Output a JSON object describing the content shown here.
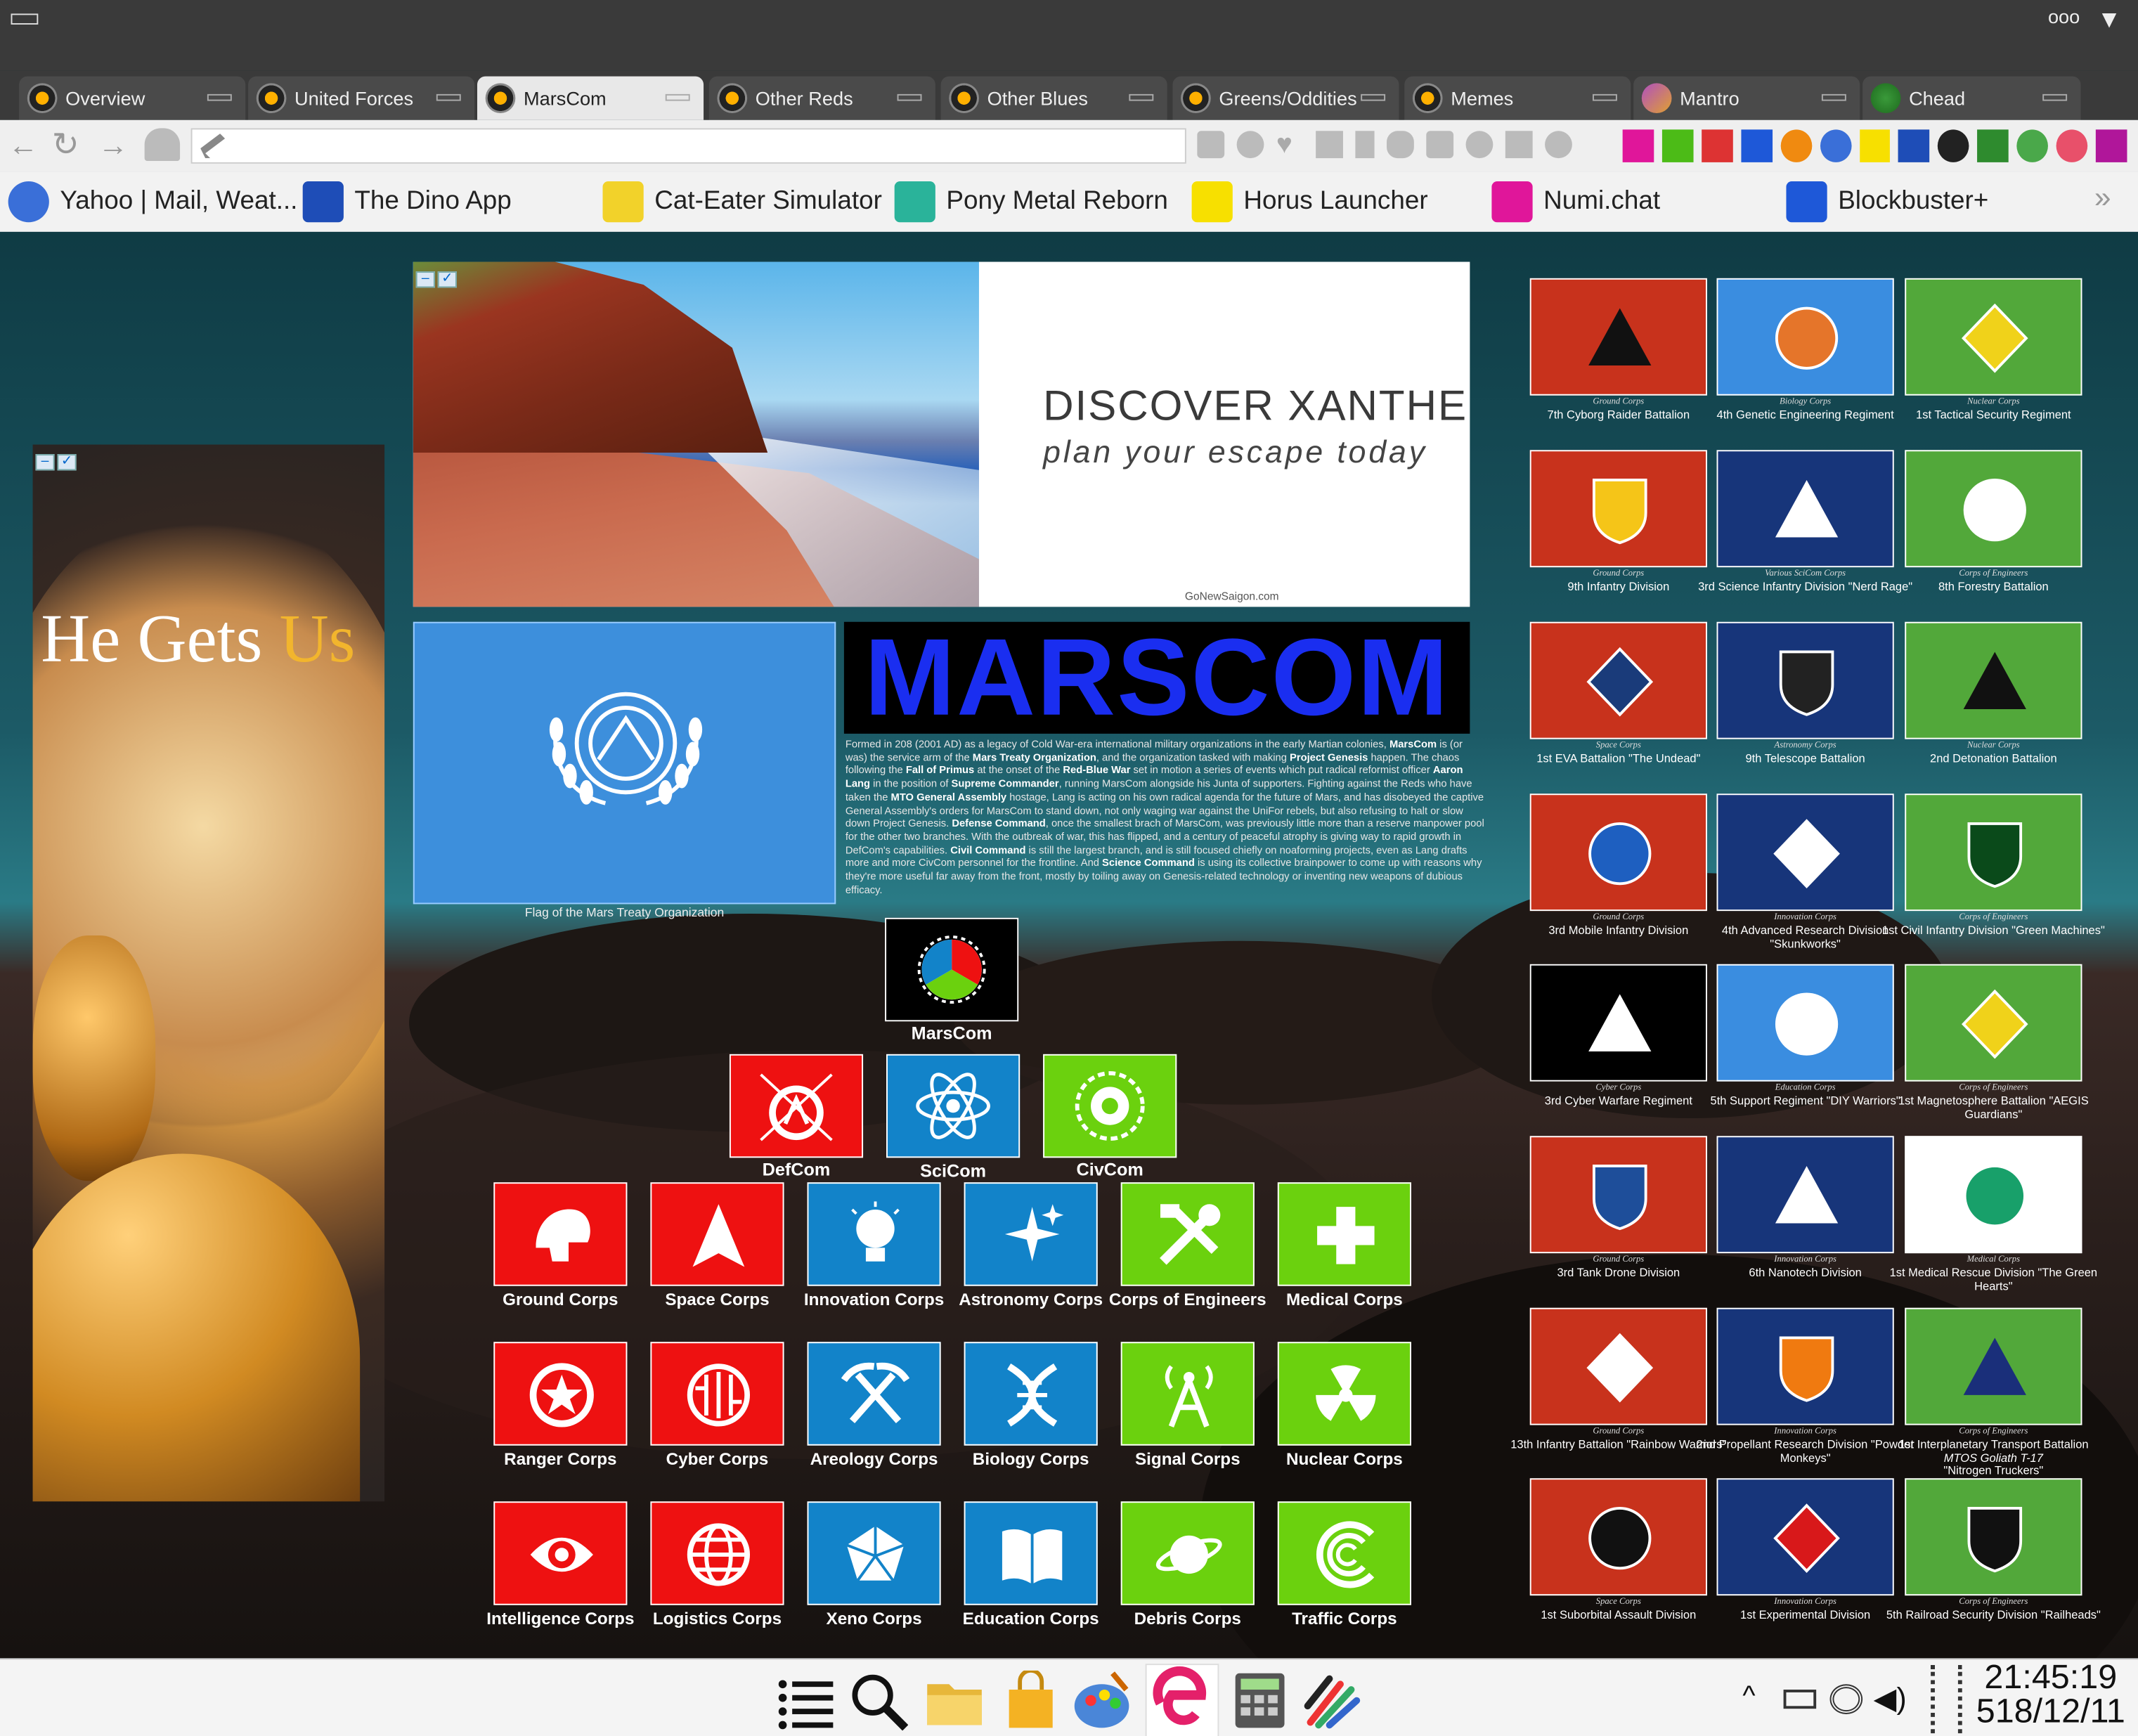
{
  "tabs": [
    {
      "label": "Overview",
      "active": false
    },
    {
      "label": "United Forces",
      "active": false
    },
    {
      "label": "MarsCom",
      "active": true
    },
    {
      "label": "Other Reds",
      "active": false
    },
    {
      "label": "Other Blues",
      "active": false
    },
    {
      "label": "Greens/Oddities",
      "active": false
    },
    {
      "label": "Memes",
      "active": false
    },
    {
      "label": "Mantro",
      "active": false
    },
    {
      "label": "Chead",
      "active": false
    }
  ],
  "bookmarks": [
    {
      "label": "Yahoo | Mail, Weat...",
      "icon": "globe-icon",
      "color": "#3a6fd8"
    },
    {
      "label": "The Dino App",
      "icon": "un-emblem-icon",
      "color": "#1e4db7"
    },
    {
      "label": "Cat-Eater Simulator",
      "icon": "cat-icon",
      "color": "#f2d22a"
    },
    {
      "label": "Pony Metal Reborn",
      "icon": "pony-icon",
      "color": "#2ab39a"
    },
    {
      "label": "Horus Launcher",
      "icon": "horus-icon",
      "color": "#f7e000"
    },
    {
      "label": "Numi.chat",
      "icon": "numi-icon",
      "color": "#e0169a"
    },
    {
      "label": "Blockbuster+",
      "icon": "blockbuster-icon",
      "color": "#1e58d8"
    }
  ],
  "titlebar": {
    "menu_glyph": "▭",
    "dots": "ooo",
    "chevron": "▼"
  },
  "bookmark_overflow": "»",
  "buddha": {
    "text_part1": "He Gets ",
    "text_part2": "Us"
  },
  "ad": {
    "headline": "DISCOVER XANTHE",
    "tagline": "plan your escape today",
    "source": "GoNewSaigon.com"
  },
  "flag": {
    "caption": "Flag of the Mars Treaty Organization",
    "color": "#3d8fdc"
  },
  "marscom": {
    "title": "MARSCOM",
    "description_html": "Formed in 208 (2001 AD) as a legacy of Cold War-era international military organizations in the early Martian colonies, <b>MarsCom</b> is (or was) the service arm of the <b>Mars Treaty Organization</b>, and the organization tasked with making <b>Project Genesis</b> happen. The chaos following the <b>Fall of Primus</b> at the onset of the <b>Red-Blue War</b> set in motion a series of events which put radical reformist officer <b>Aaron Lang</b> in the position of <b>Supreme Commander</b>, running MarsCom alongside his Junta of supporters. Fighting against the Reds who have taken the <b>MTO General Assembly</b> hostage, Lang is acting on his own radical agenda for the future of Mars, and has disobeyed the captive General Assembly's orders for MarsCom to stand down, not only waging war against the UniFor rebels, but also refusing to halt or slow down Project Genesis. <b>Defense Command</b>, once the smallest brach of MarsCom, was previously little more than a reserve manpower pool for the other two branches. With the outbreak of war, this has flipped, and a century of peaceful atrophy is giving way to rapid growth in DefCom's capabilities. <b>Civil Command</b> is still the largest branch, and is still focused chiefly on noaforming projects, even as Lang drafts more and more CivCom personnel for the frontline. And <b>Science Command</b> is using its collective brainpower to come up with reasons why they're more useful far away from the front, mostly by toiling away on Genesis-related technology or inventing new weapons of dubious efficacy."
  },
  "org": {
    "root": "MarsCom",
    "branches": [
      {
        "label": "DefCom",
        "color": "#ee1111"
      },
      {
        "label": "SciCom",
        "color": "#1283c9"
      },
      {
        "label": "CivCom",
        "color": "#6bd10e"
      }
    ]
  },
  "corps": [
    {
      "label": "Ground Corps",
      "color": "red",
      "icon": "helmet-icon"
    },
    {
      "label": "Space Corps",
      "color": "red",
      "icon": "arrowhead-icon"
    },
    {
      "label": "Innovation Corps",
      "color": "blue",
      "icon": "lightbulb-icon"
    },
    {
      "label": "Astronomy Corps",
      "color": "blue",
      "icon": "stars-icon"
    },
    {
      "label": "Corps of Engineers",
      "color": "green",
      "icon": "tools-icon"
    },
    {
      "label": "Medical Corps",
      "color": "green",
      "icon": "cross-icon"
    },
    {
      "label": "Ranger Corps",
      "color": "red",
      "icon": "star-badge-icon"
    },
    {
      "label": "Cyber Corps",
      "color": "red",
      "icon": "circuit-icon"
    },
    {
      "label": "Areology Corps",
      "color": "blue",
      "icon": "pickaxes-icon"
    },
    {
      "label": "Biology Corps",
      "color": "blue",
      "icon": "dna-icon"
    },
    {
      "label": "Signal Corps",
      "color": "green",
      "icon": "antenna-icon"
    },
    {
      "label": "Nuclear Corps",
      "color": "green",
      "icon": "radiation-icon"
    },
    {
      "label": "Intelligence Corps",
      "color": "red",
      "icon": "eye-icon"
    },
    {
      "label": "Logistics Corps",
      "color": "red",
      "icon": "globe-icon"
    },
    {
      "label": "Xeno Corps",
      "color": "blue",
      "icon": "polyhedron-icon"
    },
    {
      "label": "Education Corps",
      "color": "blue",
      "icon": "book-icon"
    },
    {
      "label": "Debris Corps",
      "color": "green",
      "icon": "planet-icon"
    },
    {
      "label": "Traffic Corps",
      "color": "green",
      "icon": "spiral-icon"
    }
  ],
  "units": [
    {
      "corps": "Ground Corps",
      "name": "7th Cyborg Raider Battalion",
      "bg": "#c8321c",
      "accent": "#111"
    },
    {
      "corps": "Biology Corps",
      "name": "4th Genetic Engineering Regiment",
      "bg": "#3a8de0",
      "accent": "#e5752a"
    },
    {
      "corps": "Nuclear Corps",
      "name": "1st Tactical Security Regiment",
      "bg": "#52a83a",
      "accent": "#f0d21a"
    },
    {
      "corps": "Ground Corps",
      "name": "9th Infantry Division",
      "bg": "#c8321c",
      "accent": "#f5c518"
    },
    {
      "corps": "Various SciCom Corps",
      "name": "3rd Science Infantry Division \"Nerd Rage\"",
      "bg": "#17357a",
      "accent": "#fff"
    },
    {
      "corps": "Corps of Engineers",
      "name": "8th Forestry Battalion",
      "bg": "#52a83a",
      "accent": "#fff"
    },
    {
      "corps": "Space Corps",
      "name": "1st EVA Battalion \"The Undead\"",
      "bg": "#c8321c",
      "accent": "#1a3b7a"
    },
    {
      "corps": "Astronomy Corps",
      "name": "9th Telescope Battalion",
      "bg": "#17357a",
      "accent": "#222"
    },
    {
      "corps": "Nuclear Corps",
      "name": "2nd Detonation Battalion",
      "bg": "#52a83a",
      "accent": "#111"
    },
    {
      "corps": "Ground Corps",
      "name": "3rd Mobile Infantry Division",
      "bg": "#c8321c",
      "accent": "#1e5fc0"
    },
    {
      "corps": "Innovation Corps",
      "name": "4th Advanced Research Division \"Skunkworks\"",
      "bg": "#17357a",
      "accent": "#fff"
    },
    {
      "corps": "Corps of Engineers",
      "name": "1st Civil Infantry Division \"Green Machines\"",
      "bg": "#52a83a",
      "accent": "#0a4a1a"
    },
    {
      "corps": "Cyber Corps",
      "name": "3rd Cyber Warfare Regiment",
      "bg": "#000",
      "accent": "#fff"
    },
    {
      "corps": "Education Corps",
      "name": "5th Support Regiment \"DIY Warriors\"",
      "bg": "#3a8de0",
      "accent": "#fff"
    },
    {
      "corps": "Corps of Engineers",
      "name": "1st Magnetosphere Battalion \"AEGIS Guardians\"",
      "bg": "#52a83a",
      "accent": "#f0d21a"
    },
    {
      "corps": "Ground Corps",
      "name": "3rd Tank Drone Division",
      "bg": "#c8321c",
      "accent": "#1e4e9a"
    },
    {
      "corps": "Innovation Corps",
      "name": "6th Nanotech Division",
      "bg": "#17357a",
      "accent": "#fff"
    },
    {
      "corps": "Medical Corps",
      "name": "1st Medical Rescue Division \"The Green Hearts\"",
      "bg": "#ffffff",
      "accent": "#18a06a"
    },
    {
      "corps": "Ground Corps",
      "name": "13th Infantry Battalion \"Rainbow Warriors\"",
      "bg": "#c8321c",
      "accent": "#fff"
    },
    {
      "corps": "Innovation Corps",
      "name": "2nd Propellant Research Division \"Powder Monkeys\"",
      "bg": "#17357a",
      "accent": "#f07a10"
    },
    {
      "corps": "Corps of Engineers",
      "name": "1st Interplanetary Transport Battalion",
      "extra": "MTOS Goliath T-17",
      "extra2": "\"Nitrogen Truckers\"",
      "bg": "#52a83a",
      "accent": "#1a2f7a"
    },
    {
      "corps": "Space Corps",
      "name": "1st Suborbital Assault Division",
      "bg": "#c8321c",
      "accent": "#111"
    },
    {
      "corps": "Innovation Corps",
      "name": "1st Experimental Division",
      "bg": "#17357a",
      "accent": "#d8181a"
    },
    {
      "corps": "Corps of Engineers",
      "name": "5th Railroad Security Division \"Railheads\"",
      "bg": "#52a83a",
      "accent": "#111"
    }
  ],
  "clock": {
    "time": "21:45:19",
    "date": "518/12/11"
  },
  "taskbar_icons": [
    "menu-icon",
    "search-icon",
    "folder-icon",
    "shopping-bag-icon",
    "palette-icon",
    "edge-icon",
    "calculator-icon",
    "app-icon"
  ]
}
